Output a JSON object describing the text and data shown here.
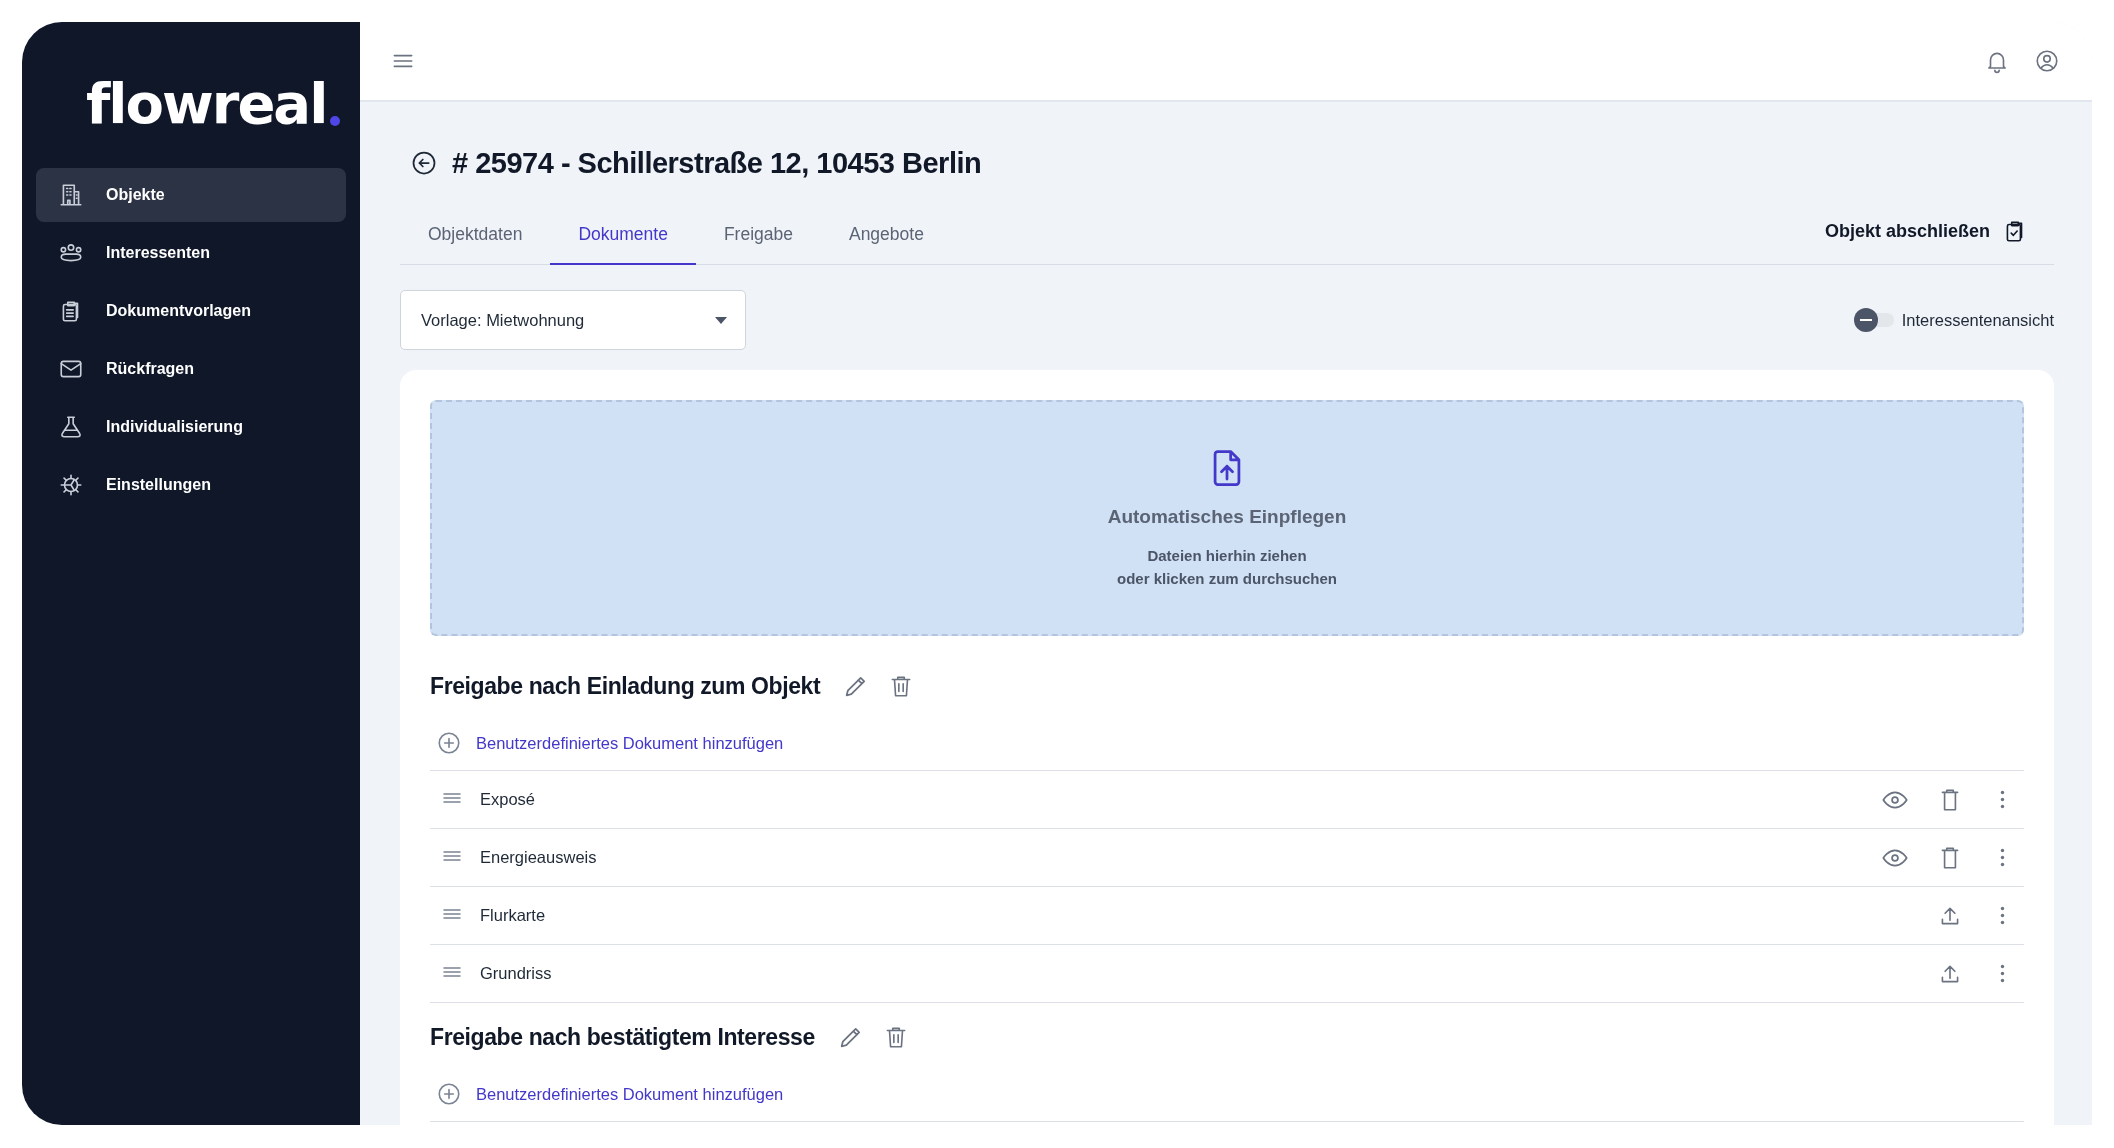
{
  "sidebar": {
    "logo": "flowreal",
    "items": [
      {
        "label": "Objekte",
        "selected": true
      },
      {
        "label": "Interessenten",
        "selected": false
      },
      {
        "label": "Dokumentvorlagen",
        "selected": false
      },
      {
        "label": "Rückfragen",
        "selected": false
      },
      {
        "label": "Individualisierung",
        "selected": false
      },
      {
        "label": "Einstellungen",
        "selected": false
      }
    ]
  },
  "page": {
    "title": "# 25974 - Schillerstraße 12, 10453 Berlin",
    "tabs": [
      {
        "label": "Objektdaten",
        "selected": false
      },
      {
        "label": "Dokumente",
        "selected": true
      },
      {
        "label": "Freigabe",
        "selected": false
      },
      {
        "label": "Angebote",
        "selected": false
      }
    ],
    "action": "Objekt abschließen",
    "template": {
      "value": "Vorlage: Mietwohnung"
    },
    "toggle": {
      "label": "Interessentenansicht",
      "on": false
    }
  },
  "dropzone": {
    "title": "Automatisches Einpflegen",
    "lines": [
      "Dateien hierhin ziehen",
      "oder klicken zum durchsuchen"
    ]
  },
  "sections": [
    {
      "title": "Freigabe nach Einladung zum Objekt",
      "add_label": "Benutzerdefiniertes Dokument hinzufügen",
      "documents": [
        {
          "name": "Exposé",
          "kind": "uploaded"
        },
        {
          "name": "Energieausweis",
          "kind": "uploaded"
        },
        {
          "name": "Flurkarte",
          "kind": "missing"
        },
        {
          "name": "Grundriss",
          "kind": "missing"
        }
      ]
    },
    {
      "title": "Freigabe nach bestätigtem Interesse",
      "add_label": "Benutzerdefiniertes Dokument hinzufügen"
    }
  ]
}
